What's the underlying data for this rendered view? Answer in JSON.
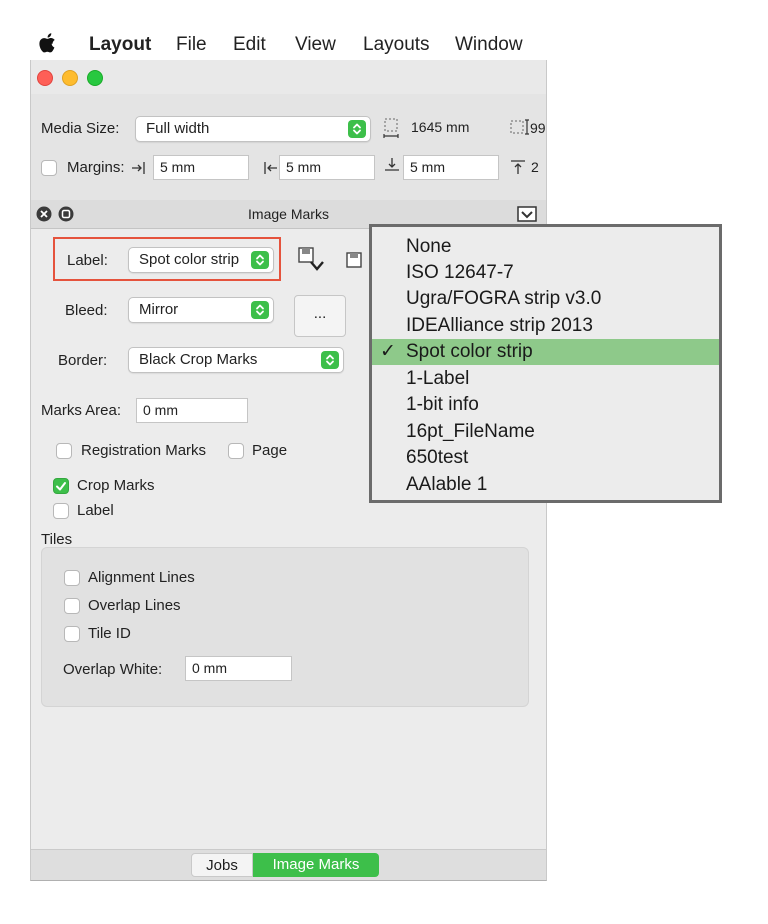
{
  "menubar": {
    "app": "Layout",
    "items": [
      "File",
      "Edit",
      "View",
      "Layouts",
      "Window"
    ]
  },
  "toolbar": {
    "media_size_label": "Media Size:",
    "media_size_value": "Full width",
    "width_value": "1645 mm",
    "height_value_partial": "99",
    "margins_label": "Margins:",
    "margin_left": "5 mm",
    "margin_right": "5 mm",
    "margin_bottom": "5 mm",
    "margin_top_partial": "2"
  },
  "panel": {
    "title": "Image Marks",
    "label_label": "Label:",
    "label_value": "Spot color strip",
    "bleed_label": "Bleed:",
    "bleed_value": "Mirror",
    "more_button": "...",
    "border_label": "Border:",
    "border_value": "Black Crop Marks",
    "marks_area_label": "Marks Area:",
    "marks_area_value": "0 mm",
    "registration_marks": "Registration Marks",
    "page": "Page",
    "crop_marks": "Crop Marks",
    "label_check": "Label",
    "tiles_title": "Tiles",
    "alignment_lines": "Alignment Lines",
    "overlap_lines": "Overlap Lines",
    "tile_id": "Tile ID",
    "overlap_white_label": "Overlap White:",
    "overlap_white_value": "0 mm"
  },
  "tabs": [
    "Jobs",
    "Image Marks"
  ],
  "dropdown": {
    "items": [
      "None",
      "ISO 12647-7",
      "Ugra/FOGRA strip v3.0",
      "IDEAlliance strip 2013",
      "Spot color strip",
      "1-Label",
      "1-bit info",
      "16pt_FileName",
      "650test",
      "AAlable 1"
    ],
    "selected": "Spot color strip",
    "check": "✓"
  },
  "colors": {
    "accent_green": "#3dbf4a",
    "highlight_red": "#e5533d",
    "selected_row": "#8ec98a"
  }
}
